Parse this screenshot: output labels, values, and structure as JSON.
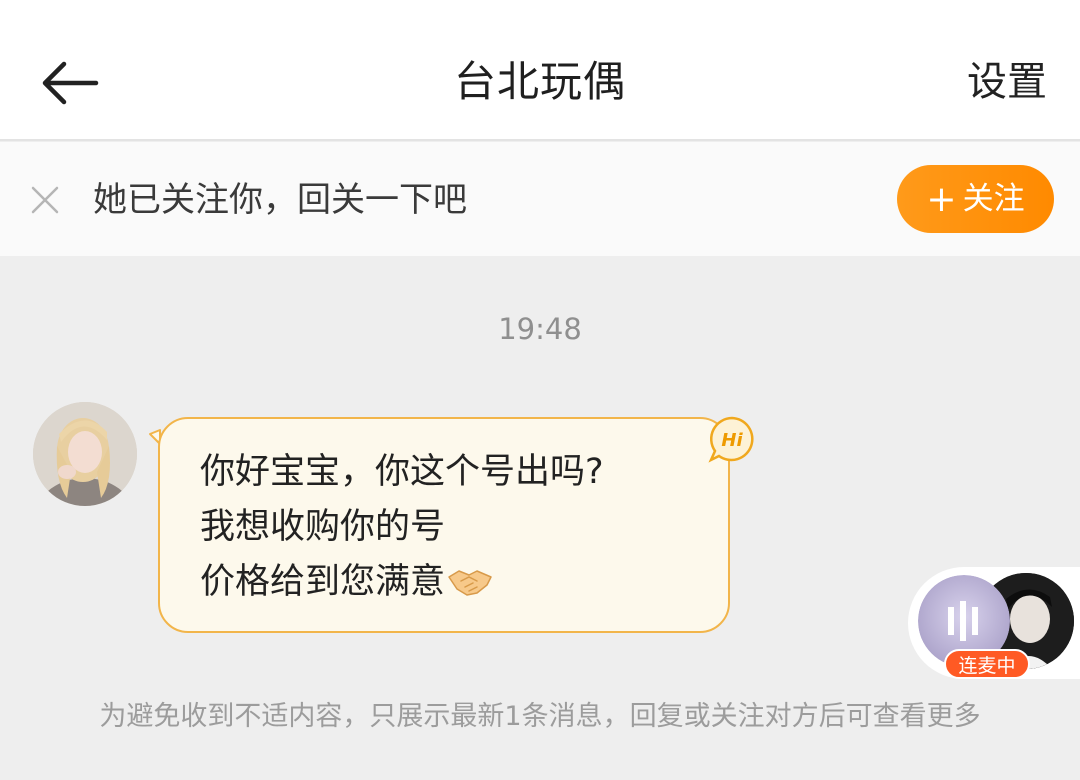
{
  "header": {
    "title": "台北玩偶",
    "settings_label": "设置"
  },
  "follow_bar": {
    "message": "她已关注你，回关一下吧",
    "button_label": "关注",
    "button_icon": "plus-icon"
  },
  "chat": {
    "timestamp": "19:48",
    "message_lines": [
      "你好宝宝，你这个号出吗?",
      "我想收购你的号",
      "价格给到您满意"
    ],
    "badge_text": "Hi"
  },
  "live": {
    "badge_label": "连麦中"
  },
  "notice": "为避免收到不适内容，只展示最新1条消息，回复或关注对方后可查看更多",
  "colors": {
    "accent": "#ff8a00",
    "bubble_bg": "#fdf9ec",
    "bubble_border": "#f2b54a",
    "live_badge": "#ff5a24"
  }
}
